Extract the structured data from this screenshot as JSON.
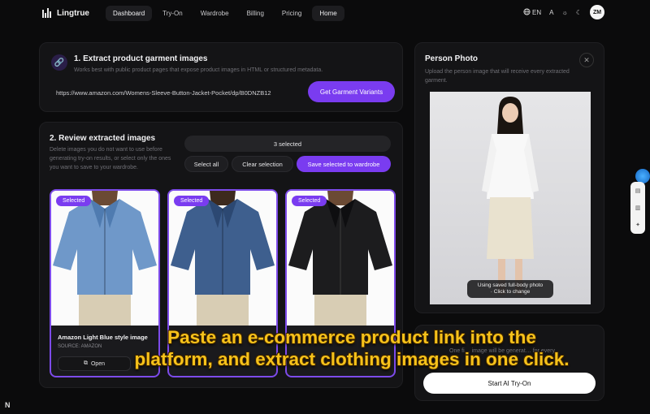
{
  "app": {
    "name": "Lingtrue"
  },
  "nav": {
    "tabs": [
      "Dashboard",
      "Try-On",
      "Wardrobe",
      "Billing",
      "Pricing",
      "Home"
    ],
    "language": "EN",
    "theme_auto": "A",
    "user_initials": "ZM"
  },
  "extract": {
    "title": "1. Extract product garment images",
    "subtitle": "Works best with public product pages that expose product images in HTML or structured metadata.",
    "url": "https://www.amazon.com/Womens-Sleeve-Button-Jacket-Pocket/dp/B0DNZB12",
    "button": "Get Garment Variants"
  },
  "review": {
    "title": "2. Review extracted images",
    "subtitle": "Delete images you do not want to use before generating try-on results, or select only the ones you want to save to your wardrobe.",
    "selected_count": "3 selected",
    "select_all": "Select all",
    "clear_selection": "Clear selection",
    "save_selected": "Save selected to wardrobe",
    "cards": [
      {
        "badge": "Selected",
        "title": "Amazon Light Blue style image",
        "source": "SOURCE: AMAZON",
        "open": "Open",
        "shirt_color": "#6f98c9",
        "shirt_shade": "#4f7bb0"
      },
      {
        "badge": "Selected",
        "title": "",
        "source": "",
        "open": "",
        "shirt_color": "#3e5f8e",
        "shirt_shade": "#2c4872"
      },
      {
        "badge": "Selected",
        "title": "",
        "source": "",
        "open": "",
        "shirt_color": "#1c1c1e",
        "shirt_shade": "#0e0e10"
      }
    ]
  },
  "person": {
    "title": "Person Photo",
    "subtitle": "Upload the person image that will receive every extracted garment.",
    "photo_tag_line1": "Using saved full-body photo",
    "photo_tag_line2": "· Click to change"
  },
  "tryon": {
    "note": "One fi… image will be generat… for every",
    "button": "Start AI Try-On"
  },
  "caption": {
    "line1": "Paste an e-commerce product link into the",
    "line2": "platform, and extract clothing images in one click."
  },
  "colors": {
    "accent": "#7a3cf0",
    "caption": "#f7c21a"
  }
}
